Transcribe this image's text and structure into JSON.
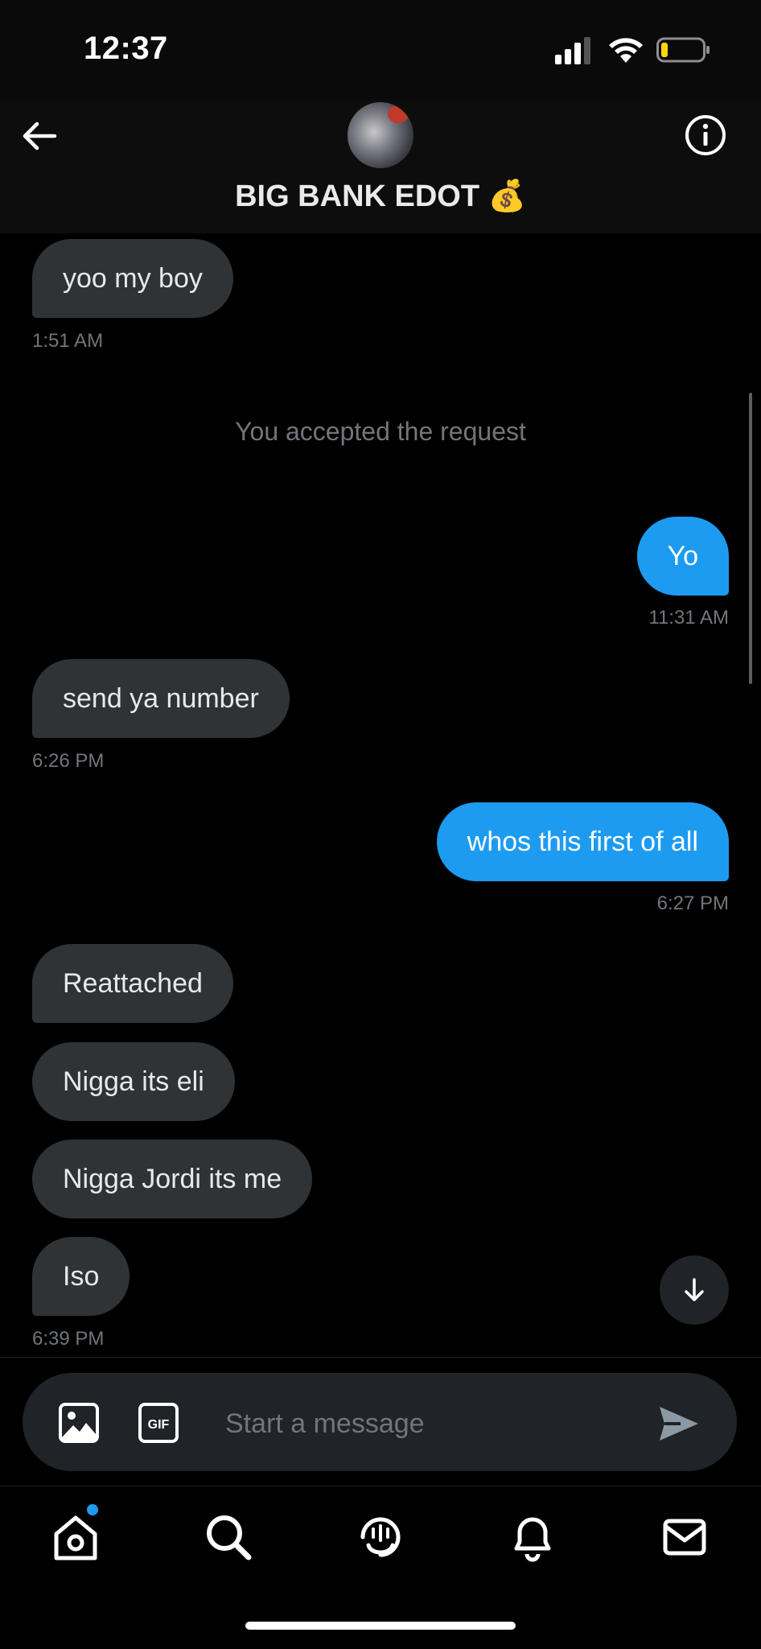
{
  "status_bar": {
    "time": "12:37"
  },
  "header": {
    "title": "BIG BANK EDOT 💰"
  },
  "messages": [
    {
      "text": "yoo my boy",
      "time": "1:51 AM"
    },
    {
      "system": "You accepted the request"
    },
    {
      "text": "Yo",
      "time": "11:31 AM"
    },
    {
      "text": "send ya number",
      "time": "6:26 PM"
    },
    {
      "text": "whos this first of all",
      "time": "6:27 PM"
    },
    {
      "text": "Reattached"
    },
    {
      "text": "Nigga its eli"
    },
    {
      "text": "Nigga Jordi its me"
    },
    {
      "text": "Iso",
      "time": "6:39 PM"
    }
  ],
  "composer": {
    "placeholder": "Start a message",
    "gif_label": "GIF"
  },
  "colors": {
    "accent": "#1d9bf0",
    "incoming_bubble": "#2f3336",
    "background": "#000000"
  },
  "icons": [
    "back-arrow-icon",
    "info-icon",
    "image-icon",
    "gif-icon",
    "send-icon",
    "home-icon",
    "search-icon",
    "spaces-icon",
    "bell-icon",
    "mail-icon",
    "arrow-down-icon"
  ]
}
